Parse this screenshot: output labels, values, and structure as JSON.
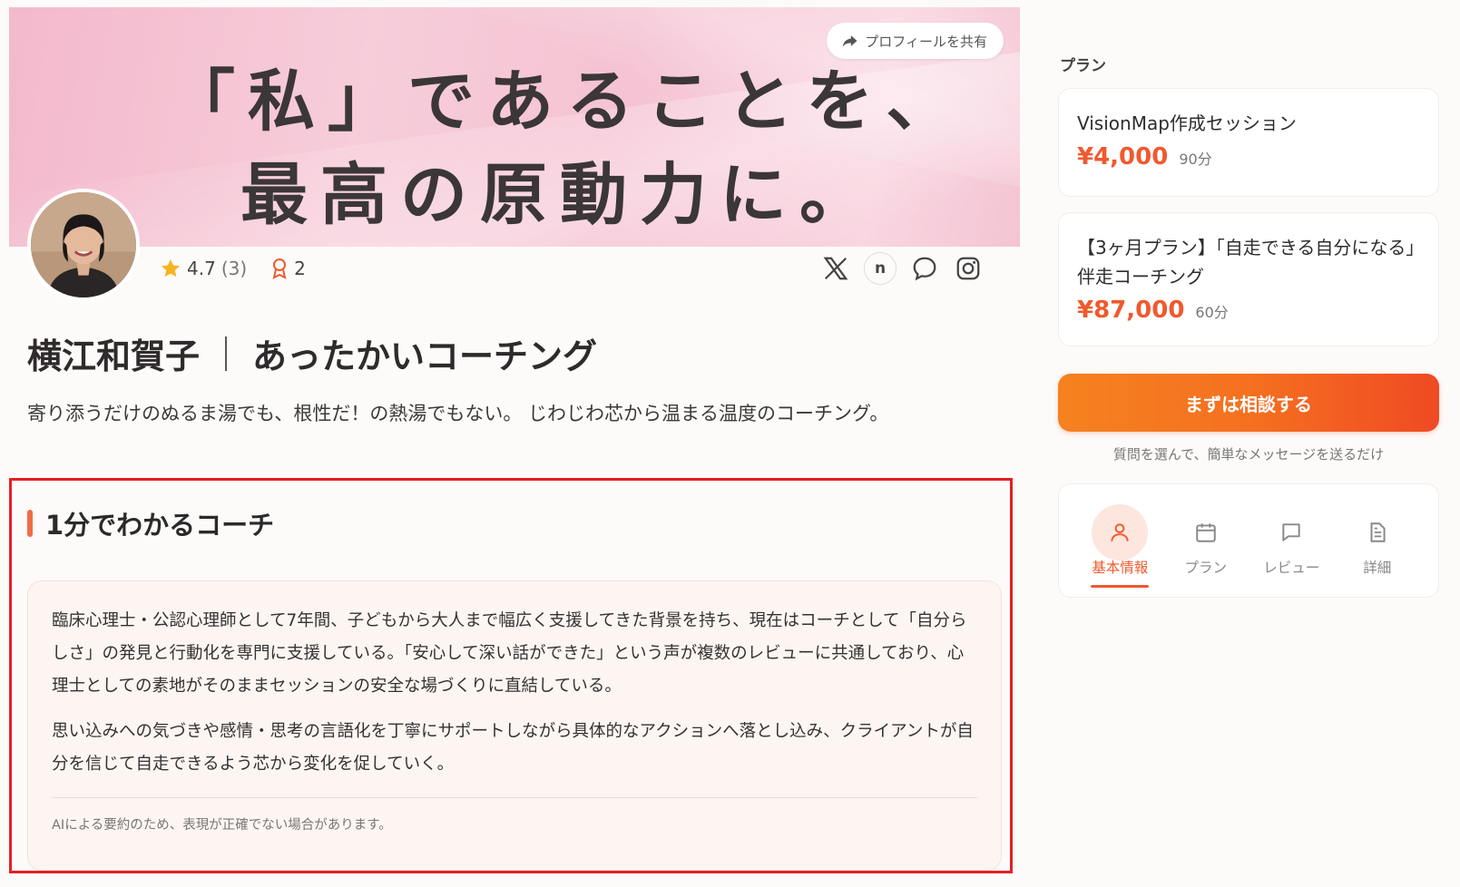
{
  "hero": {
    "line1": "「私」であることを、",
    "line2": "最高の原動力に。",
    "share_label": "プロフィールを共有"
  },
  "profile": {
    "rating": "4.7",
    "rating_count": "(3)",
    "badge_count": "2",
    "name": "横江和賀子",
    "headline": "あったかいコーチング",
    "tagline": "寄り添うだけのぬるま湯でも、根性だ！の熱湯でもない。 じわじわ芯から温まる温度のコーチング。",
    "socials": [
      "x-icon",
      "note-icon",
      "chat-icon",
      "instagram-icon"
    ],
    "note_letter": "n"
  },
  "summary": {
    "heading": "1分でわかるコーチ",
    "paragraph1": "臨床心理士・公認心理師として7年間、子どもから大人まで幅広く支援してきた背景を持ち、現在はコーチとして「自分らしさ」の発見と行動化を専門に支援している。「安心して深い話ができた」という声が複数のレビューに共通しており、心理士としての素地がそのままセッションの安全な場づくりに直結している。",
    "paragraph2": "思い込みへの気づきや感情・思考の言語化を丁寧にサポートしながら具体的なアクションへ落とし込み、クライアントが自分を信じて自走できるよう芯から変化を促していく。",
    "disclaimer": "AIによる要約のため、表現が正確でない場合があります。"
  },
  "sidebar": {
    "plan_label": "プラン",
    "plans": [
      {
        "name": "VisionMap作成セッション",
        "price": "¥4,000",
        "duration": "90分"
      },
      {
        "name": "【3ヶ月プラン】「自走できる自分になる」伴走コーチング",
        "price": "¥87,000",
        "duration": "60分"
      }
    ],
    "cta_label": "まずは相談する",
    "cta_sub": "質問を選んで、簡単なメッセージを送るだけ",
    "nav": [
      {
        "label": "基本情報",
        "icon": "person-icon",
        "active": true
      },
      {
        "label": "プラン",
        "icon": "calendar-icon",
        "active": false
      },
      {
        "label": "レビュー",
        "icon": "comment-icon",
        "active": false
      },
      {
        "label": "詳細",
        "icon": "document-icon",
        "active": false
      }
    ]
  },
  "colors": {
    "accent": "#ef5a2e",
    "highlight_border": "#e61e25",
    "hero_pink": "#f5c3d3"
  }
}
